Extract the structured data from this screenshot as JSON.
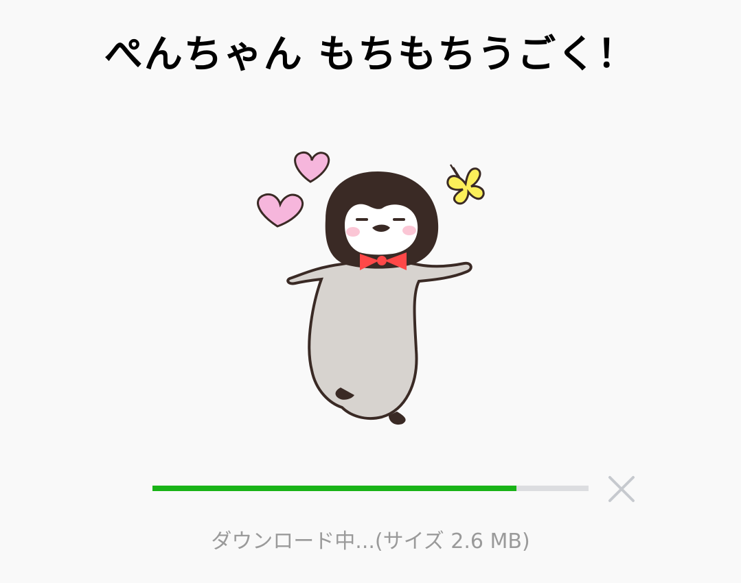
{
  "title": "ぺんちゃん もちもちうごく！",
  "sticker": {
    "icon": "penguin-sticker"
  },
  "download": {
    "progress_fraction": 0.835,
    "status_text": "ダウンロード中...(サイズ 2.6 MB)",
    "close_icon": "close-icon",
    "accent_color": "#19b317",
    "track_color": "#dcdde0"
  }
}
